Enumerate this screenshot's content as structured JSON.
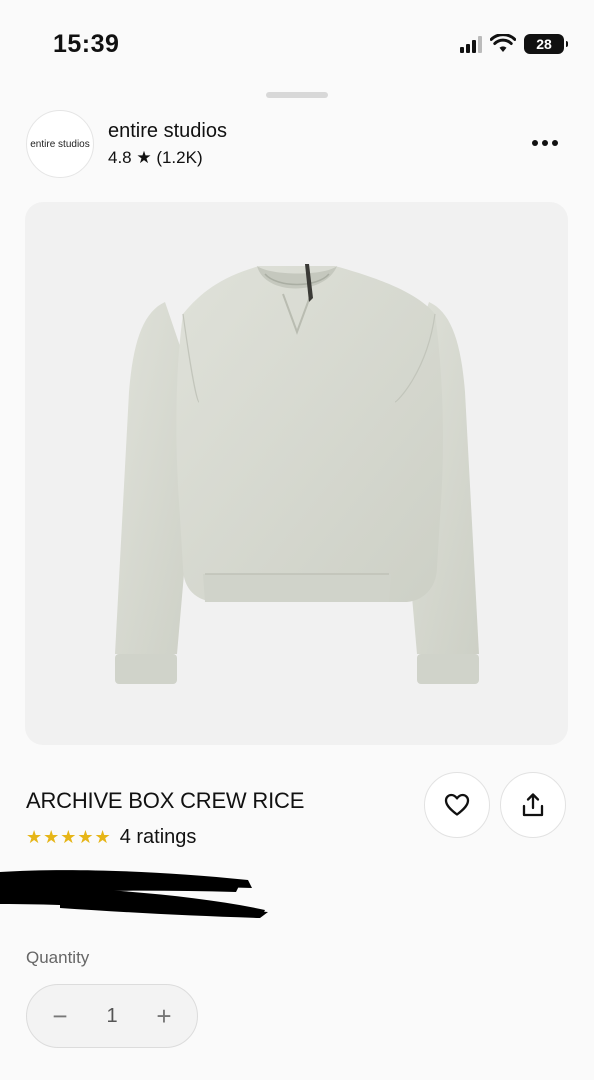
{
  "status_bar": {
    "time": "15:39",
    "battery": "28",
    "icons": [
      "signal-icon",
      "wifi-icon",
      "battery-icon"
    ]
  },
  "shop": {
    "logo_text": "entire studios",
    "name": "entire studios",
    "rating": "4.8 ★ (1.2K)"
  },
  "product": {
    "title": "ARCHIVE BOX CREW RICE",
    "stars": "★★★★★",
    "rating_label": "4 ratings",
    "image_color": "#d8dbd2"
  },
  "quantity": {
    "label": "Quantity",
    "value": "1",
    "decrement": "−",
    "increment": "+"
  },
  "colors": {
    "star": "#e6b517",
    "background": "#fafafa"
  }
}
